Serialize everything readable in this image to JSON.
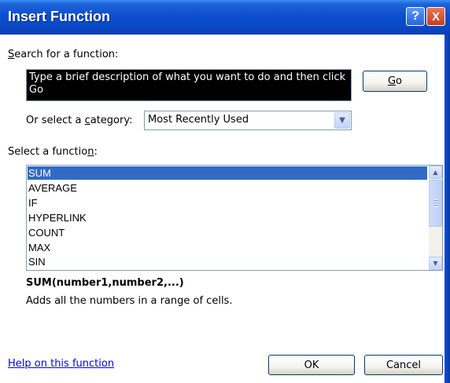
{
  "window": {
    "title": "Insert Function",
    "help_button": "?",
    "close_button": "X"
  },
  "search": {
    "label_pre": "",
    "label_accel": "S",
    "label_post": "earch for a function:",
    "value": "Type a brief description of what you want to do and then click Go",
    "go_accel": "G",
    "go_post": "o"
  },
  "category": {
    "label_pre": "Or select a ",
    "label_accel": "c",
    "label_post": "ategory:",
    "selected": "Most Recently Used"
  },
  "function_list": {
    "label_pre": "Select a functio",
    "label_accel": "n",
    "label_post": ":",
    "items": [
      "SUM",
      "AVERAGE",
      "IF",
      "HYPERLINK",
      "COUNT",
      "MAX",
      "SIN"
    ],
    "selected": "SUM"
  },
  "details": {
    "signature": "SUM(number1,number2,...)",
    "description": "Adds all the numbers in a range of cells."
  },
  "footer": {
    "help_link": "Help on this function",
    "ok": "OK",
    "cancel": "Cancel"
  },
  "colors": {
    "title_bar": "#0a47c4",
    "selection": "#316ac5",
    "link": "#0000ff"
  }
}
